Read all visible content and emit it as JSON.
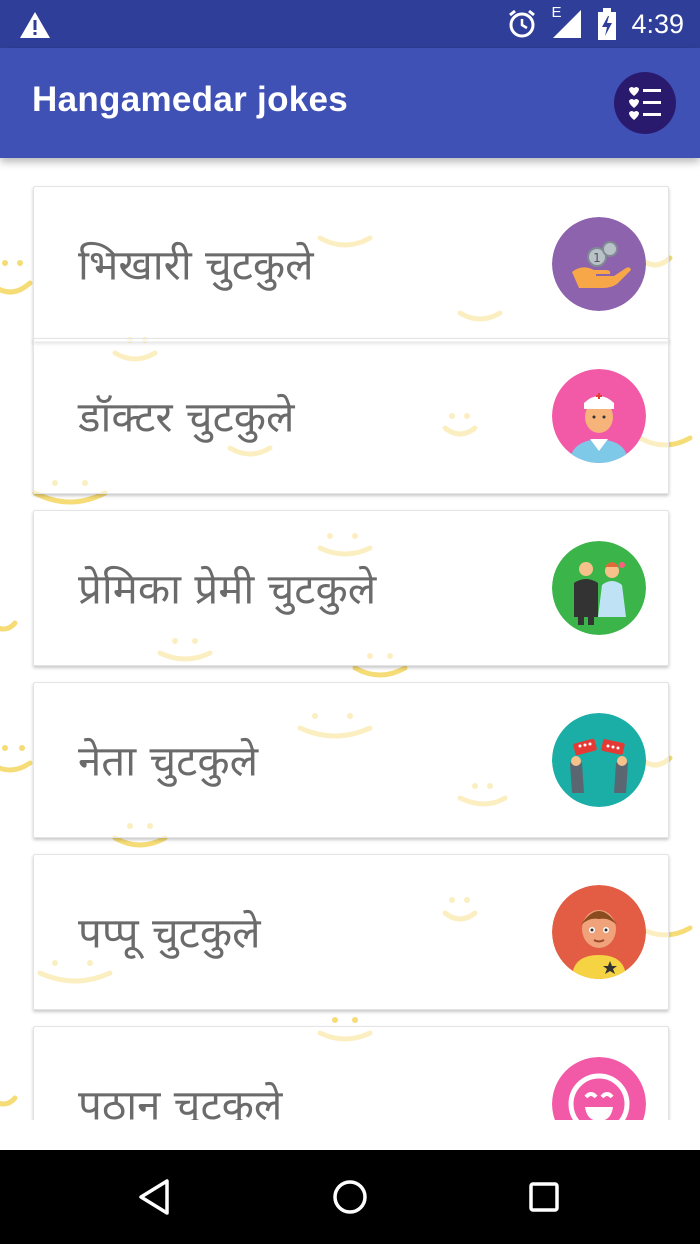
{
  "status_bar": {
    "time": "4:39",
    "network_label": "E",
    "icons": [
      "warning-icon",
      "alarm-icon",
      "signal-icon",
      "battery-icon"
    ]
  },
  "app_bar": {
    "title": "Hangamedar jokes",
    "menu_icon": "heart-list-icon",
    "color": "#3f51b5"
  },
  "categories": [
    {
      "label": "भिखारी चुटकुले",
      "icon": "coins-hand-icon",
      "icon_bg": "#8e63ad"
    },
    {
      "label": "डॉक्टर चुटकुले",
      "icon": "doctor-icon",
      "icon_bg": "#f25aa8"
    },
    {
      "label": "प्रेमिका प्रेमी चुटकुले",
      "icon": "couple-icon",
      "icon_bg": "#3bb54a"
    },
    {
      "label": "नेता चुटकुले",
      "icon": "politician-hands-icon",
      "icon_bg": "#1aaea6"
    },
    {
      "label": "पप्पू चुटकुले",
      "icon": "pappu-icon",
      "icon_bg": "#e35c44"
    },
    {
      "label": "पठान चुटकुले",
      "icon": "laughing-face-icon",
      "icon_bg": "#f25aa8"
    }
  ],
  "nav_bar": {
    "back_icon": "back-triangle-icon",
    "home_icon": "home-circle-icon",
    "recents_icon": "recents-square-icon"
  },
  "colors": {
    "status_bar": "#2f3e99",
    "background_smiley": "#f6dc76"
  }
}
